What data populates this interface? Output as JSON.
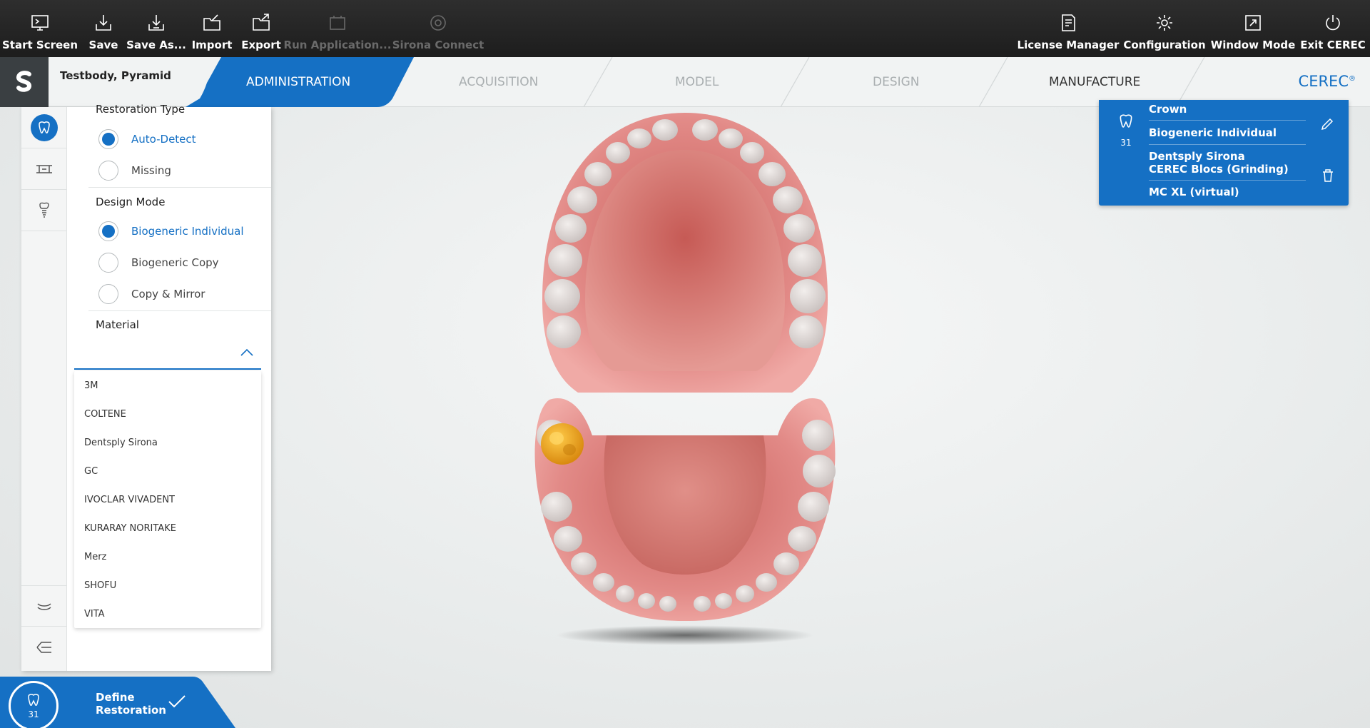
{
  "toolbar": {
    "left": [
      {
        "label": "Start Screen",
        "icon": "start-screen-icon"
      },
      {
        "label": "Save",
        "icon": "save-icon"
      },
      {
        "label": "Save As...",
        "icon": "save-as-icon"
      },
      {
        "label": "Import",
        "icon": "import-icon"
      },
      {
        "label": "Export",
        "icon": "export-icon"
      },
      {
        "label": "Run Application...",
        "icon": "run-application-icon"
      },
      {
        "label": "Sirona Connect",
        "icon": "sirona-connect-icon"
      }
    ],
    "right": [
      {
        "label": "License Manager",
        "icon": "license-manager-icon"
      },
      {
        "label": "Configuration",
        "icon": "gear-icon"
      },
      {
        "label": "Window Mode",
        "icon": "window-mode-icon"
      },
      {
        "label": "Exit CEREC",
        "icon": "power-icon"
      }
    ]
  },
  "workflow": {
    "patient": "Testbody, Pyramid",
    "steps": [
      "ADMINISTRATION",
      "ACQUISITION",
      "MODEL",
      "DESIGN",
      "MANUFACTURE"
    ],
    "active_step": "ADMINISTRATION",
    "brand": "CEREC",
    "brand_mark": "®"
  },
  "panel": {
    "restoration_type": {
      "title": "Restoration Type",
      "options": [
        "Auto-Detect",
        "Missing"
      ],
      "selected": "Auto-Detect"
    },
    "design_mode": {
      "title": "Design Mode",
      "options": [
        "Biogeneric Individual",
        "Biogeneric Copy",
        "Copy & Mirror"
      ],
      "selected": "Biogeneric Individual"
    },
    "material": {
      "title": "Material",
      "value": "",
      "options": [
        "3M",
        "COLTENE",
        "Dentsply Sirona",
        "GC",
        "IVOCLAR VIVADENT",
        "KURARAY NORITAKE",
        "Merz",
        "SHOFU",
        "VITA"
      ]
    }
  },
  "stage": {
    "tooth_number": "31",
    "line1": "Define",
    "line2": "Restoration"
  },
  "restoration_card": {
    "tooth_number": "31",
    "type": "Crown",
    "design": "Biogeneric Individual",
    "material_line1": "Dentsply Sirona",
    "material_line2": "CEREC Blocs (Grinding)",
    "machine": "MC XL (virtual)"
  },
  "colors": {
    "accent": "#1570c4",
    "toolbar": "#262626",
    "selected_tooth": "#e8a020"
  }
}
